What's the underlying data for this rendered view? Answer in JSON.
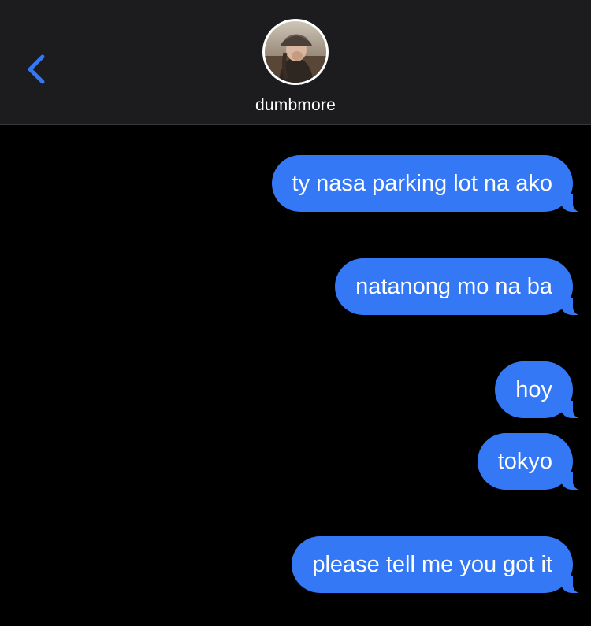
{
  "header": {
    "back_icon": "chevron-left-icon",
    "contact_name": "dumbmore",
    "accent_color": "#3478f6"
  },
  "messages": [
    {
      "text": "ty nasa parking lot na ako",
      "sender": "me"
    },
    {
      "text": "natanong mo na ba",
      "sender": "me"
    },
    {
      "text": "hoy",
      "sender": "me"
    },
    {
      "text": "tokyo",
      "sender": "me"
    },
    {
      "text": "please tell me you got it",
      "sender": "me"
    }
  ],
  "colors": {
    "background": "#000000",
    "header_background": "#1c1c1e",
    "bubble": "#3478f6",
    "bubble_text": "#ffffff"
  }
}
